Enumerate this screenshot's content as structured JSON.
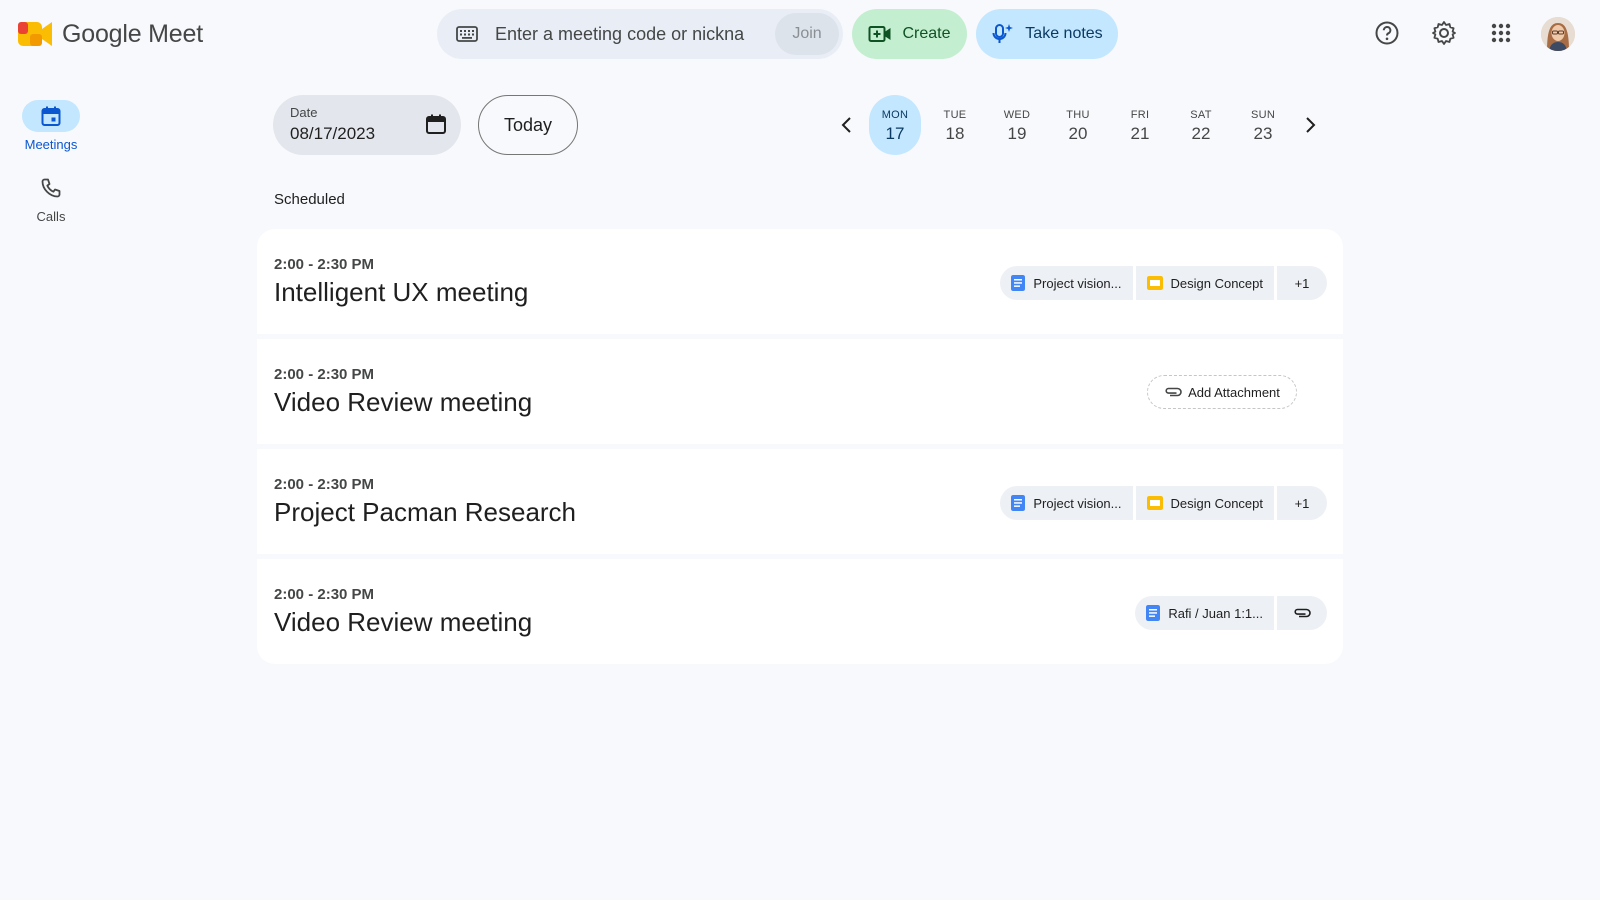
{
  "brand": {
    "name": "Google Meet"
  },
  "search": {
    "placeholder": "Enter a meeting code or nickname",
    "join_label": "Join"
  },
  "actions": {
    "create_label": "Create",
    "notes_label": "Take notes"
  },
  "header_icons": [
    "help-icon",
    "settings-icon",
    "apps-grid-icon"
  ],
  "nav": {
    "items": [
      {
        "label": "Meetings",
        "icon": "calendar-icon",
        "active": true
      },
      {
        "label": "Calls",
        "icon": "phone-icon",
        "active": false
      }
    ]
  },
  "date_picker": {
    "label": "Date",
    "value": "08/17/2023",
    "today_label": "Today"
  },
  "week": [
    {
      "day": "MON",
      "date": "17",
      "selected": true
    },
    {
      "day": "TUE",
      "date": "18",
      "selected": false
    },
    {
      "day": "WED",
      "date": "19",
      "selected": false
    },
    {
      "day": "THU",
      "date": "20",
      "selected": false
    },
    {
      "day": "FRI",
      "date": "21",
      "selected": false
    },
    {
      "day": "SAT",
      "date": "22",
      "selected": false
    },
    {
      "day": "SUN",
      "date": "23",
      "selected": false
    }
  ],
  "section_title": "Scheduled",
  "meetings": [
    {
      "time": "2:00 - 2:30 PM",
      "title": "Intelligent UX meeting",
      "attachments": [
        {
          "label": "Project vision...",
          "type": "doc"
        },
        {
          "label": "Design Concept",
          "type": "slides"
        }
      ],
      "more": "+1"
    },
    {
      "time": "2:00 - 2:30 PM",
      "title": "Video Review meeting",
      "add_attachment_label": "Add Attachment"
    },
    {
      "time": "2:00 - 2:30 PM",
      "title": "Project Pacman Research",
      "attachments": [
        {
          "label": "Project vision...",
          "type": "doc"
        },
        {
          "label": "Design Concept",
          "type": "slides"
        }
      ],
      "more": "+1"
    },
    {
      "time": "2:00 - 2:30 PM",
      "title": "Video Review meeting",
      "attachments": [
        {
          "label": "Rafi / Juan 1:1...",
          "type": "doc"
        }
      ],
      "attach_icon": "paperclip-icon"
    }
  ],
  "colors": {
    "doc": "#4285f4",
    "slides": "#fbbc04",
    "accent_blue": "#c2e7ff",
    "accent_green": "#c4eed0"
  }
}
